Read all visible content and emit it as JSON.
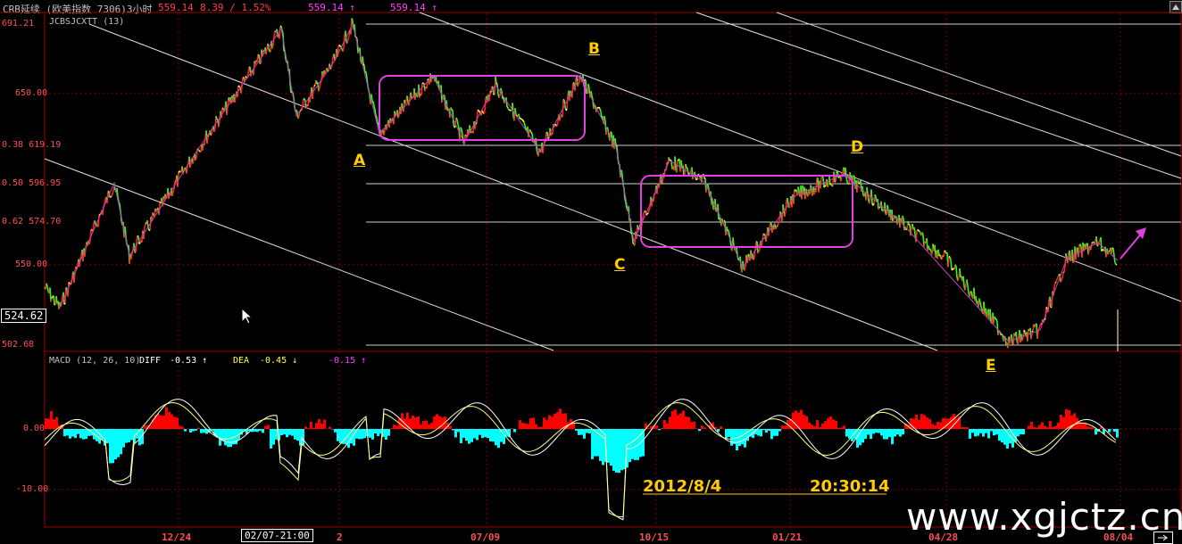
{
  "header": {
    "instrument": "CRB延续 (欧美指数 7306)3小时",
    "price": "559.14",
    "change": "8.39 / 1.52%",
    "marker1": "559.14 ↑",
    "marker2": "559.14 ↑"
  },
  "indicator_label": "JCBSJCXTT (13)",
  "price_axis": [
    "691.21",
    "650.00",
    "0.38 619.19",
    "0.50 596.95",
    "0.62 574.70",
    "550.00",
    "502.68"
  ],
  "current_price_box": "524.62",
  "points": {
    "A": "A",
    "B": "B",
    "C": "C",
    "D": "D",
    "E": "E"
  },
  "macd": {
    "title": "MACD (12, 26, 10)",
    "diff_label": "DIFF",
    "diff_value": "-0.53 ↑",
    "dea_label": "DEA",
    "dea_value": "-0.45 ↓",
    "macd_value": "-0.15 ↑",
    "axis": [
      "0.00",
      "-10.00"
    ]
  },
  "x_axis": [
    "12/24",
    "2",
    "07/09",
    "10/15",
    "01/21",
    "04/28",
    "08/04"
  ],
  "crosshair_time": "02/07-21:00",
  "annotation": {
    "date": "2012/8/4",
    "time": "20:30:14"
  },
  "watermark": "www.xgjctz.cn",
  "colors": {
    "up": "#ff2020",
    "down": "#20ff20",
    "flat": "#ffff40",
    "box": "#e040e0",
    "grid": "#800000",
    "hist_up": "#ff0000",
    "hist_down": "#00ffff"
  }
}
